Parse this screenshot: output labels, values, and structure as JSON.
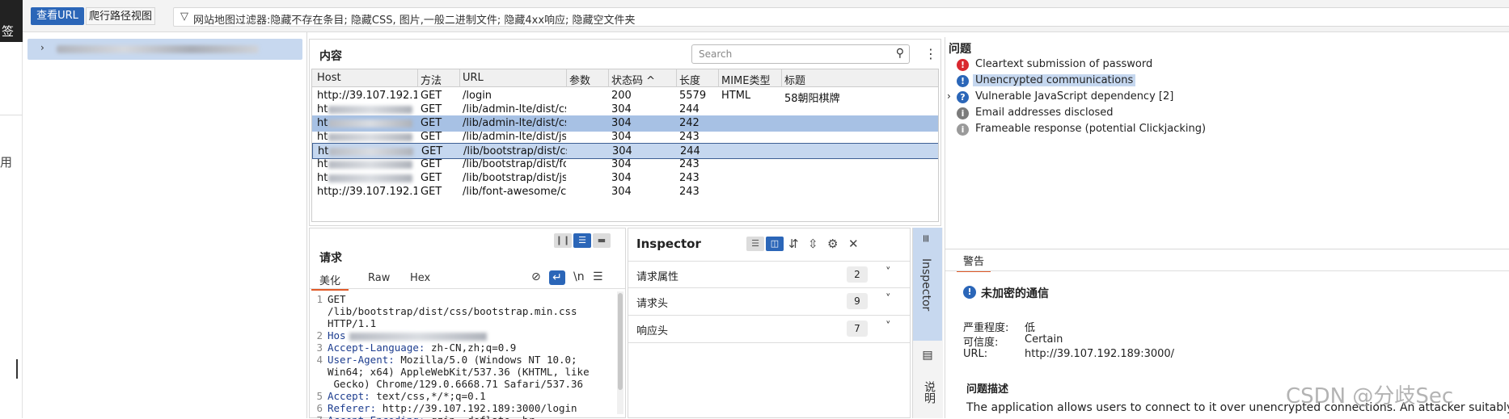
{
  "left_strip": {
    "glyph_top": "签",
    "glyph_mid": "用"
  },
  "toolbar": {
    "view_url": "查看URL",
    "crawl_path": "爬行路径视图",
    "filter_icon": "filter-icon",
    "filter_text": "网站地图过滤器:隐藏不存在条目; 隐藏CSS, 图片,一般二进制文件; 隐藏4xx响应; 隐藏空文件夹"
  },
  "content": {
    "title": "内容",
    "search_placeholder": "Search",
    "columns": [
      "Host",
      "方法",
      "URL",
      "参数",
      "状态码 ^",
      "长度",
      "MIME类型",
      "标题"
    ],
    "rows": [
      {
        "host": "http://39.107.192.18...",
        "method": "GET",
        "url": "/login",
        "params": "",
        "status": "200",
        "length": "5579",
        "mime": "HTML",
        "title": "58朝阳棋牌",
        "blur": false
      },
      {
        "host": "ht",
        "method": "GET",
        "url": "/lib/admin-lte/dist/css...",
        "params": "",
        "status": "304",
        "length": "244",
        "mime": "",
        "title": "",
        "blur": true
      },
      {
        "host": "ht",
        "method": "GET",
        "url": "/lib/admin-lte/dist/css...",
        "params": "",
        "status": "304",
        "length": "242",
        "mime": "",
        "title": "",
        "blur": true
      },
      {
        "host": "ht",
        "method": "GET",
        "url": "/lib/admin-lte/dist/js/a...",
        "params": "",
        "status": "304",
        "length": "243",
        "mime": "",
        "title": "",
        "blur": true
      },
      {
        "host": "ht",
        "method": "GET",
        "url": "/lib/bootstrap/dist/css...",
        "params": "",
        "status": "304",
        "length": "244",
        "mime": "",
        "title": "",
        "blur": true
      },
      {
        "host": "ht",
        "method": "GET",
        "url": "/lib/bootstrap/dist/fon...",
        "params": "",
        "status": "304",
        "length": "243",
        "mime": "",
        "title": "",
        "blur": true
      },
      {
        "host": "ht",
        "method": "GET",
        "url": "/lib/bootstrap/dist/js/...",
        "params": "",
        "status": "304",
        "length": "243",
        "mime": "",
        "title": "",
        "blur": true
      },
      {
        "host": "http://39.107.192.18",
        "method": "GET",
        "url": "/lib/font-awesome/css",
        "params": "",
        "status": "304",
        "length": "243",
        "mime": "",
        "title": "",
        "blur": false
      }
    ]
  },
  "issues": {
    "title": "问题",
    "items": [
      {
        "text": "Cleartext submission of password",
        "icon": "!",
        "color": "#d9282f",
        "highlight": false
      },
      {
        "text": "Unencrypted communications",
        "icon": "!",
        "color": "#2b66b8",
        "highlight": true
      },
      {
        "text": "Vulnerable JavaScript dependency [2]",
        "icon": "?",
        "color": "#2b66b8",
        "highlight": false
      },
      {
        "text": "Email addresses disclosed",
        "icon": "i",
        "color": "#7b7b7b",
        "highlight": false
      },
      {
        "text": "Frameable response (potential Clickjacking)",
        "icon": "i",
        "color": "#9a9a9a",
        "highlight": false
      }
    ]
  },
  "advisory": {
    "tab": "警告",
    "title": "未加密的通信",
    "severity_label": "严重程度:",
    "severity_value": "低",
    "confidence_label": "可信度:",
    "confidence_value": "Certain",
    "url_label": "URL:",
    "url_value": "http://39.107.192.189:3000/",
    "section": "问题描述",
    "description": "The application allows users to connect to it over unencrypted connections. An attacker suitably"
  },
  "request": {
    "title": "请求",
    "tabs": [
      "美化",
      "Raw",
      "Hex"
    ],
    "newline_label": "\\n",
    "lines": [
      {
        "n": "1",
        "text": "GET"
      },
      {
        "n": "",
        "text": "/lib/bootstrap/dist/css/bootstrap.min.css"
      },
      {
        "n": "",
        "text": "HTTP/1.1"
      },
      {
        "n": "2",
        "key": "Hos",
        "text": ""
      },
      {
        "n": "3",
        "key": "Accept-Language:",
        "text": " zh-CN,zh;q=0.9"
      },
      {
        "n": "4",
        "key": "User-Agent:",
        "text": " Mozilla/5.0 (Windows NT 10.0;"
      },
      {
        "n": "",
        "text": "Win64; x64) AppleWebKit/537.36 (KHTML, like"
      },
      {
        "n": "",
        "text": " Gecko) Chrome/129.0.6668.71 Safari/537.36"
      },
      {
        "n": "5",
        "key": "Accept:",
        "text": " text/css,*/*;q=0.1"
      },
      {
        "n": "6",
        "key": "Referer:",
        "text": " http://39.107.192.189:3000/login"
      },
      {
        "n": "7",
        "key": "Accept-Encoding:",
        "text": " gzip, deflate, br"
      }
    ]
  },
  "inspector": {
    "title": "Inspector",
    "sections": [
      {
        "label": "请求属性",
        "count": "2"
      },
      {
        "label": "请求头",
        "count": "9"
      },
      {
        "label": "响应头",
        "count": "7"
      }
    ]
  },
  "side_tabs": {
    "inspector": "Inspector",
    "notes": "说明"
  },
  "watermark": "CSDN @分歧Sec"
}
